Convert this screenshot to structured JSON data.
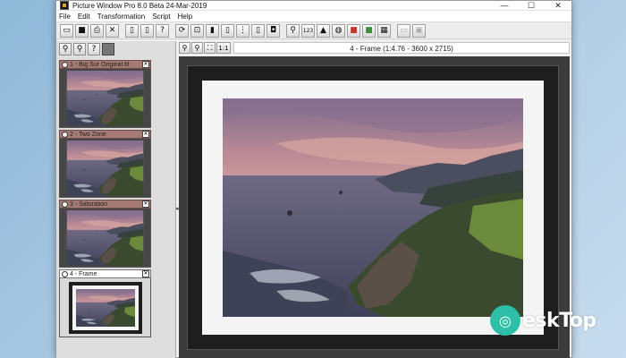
{
  "window": {
    "title": "Picture Window Pro 8.0 Beta 24-Mar-2019",
    "controls": {
      "minimize": "—",
      "maximize": "☐",
      "close": "✕"
    }
  },
  "menu": [
    "File",
    "Edit",
    "Transformation",
    "Script",
    "Help"
  ],
  "toolbar": {
    "buttons": [
      {
        "name": "new-window-button",
        "glyph": "▭"
      },
      {
        "name": "open-button",
        "glyph": "■"
      },
      {
        "name": "print-button",
        "glyph": "⎙"
      },
      {
        "name": "close-image-button",
        "glyph": "✕"
      },
      {
        "name": "copy-button",
        "glyph": "▯"
      },
      {
        "name": "paste-button",
        "glyph": "▯"
      },
      {
        "name": "help-button",
        "glyph": "?"
      },
      {
        "name": "rotate-button",
        "glyph": "⟳"
      },
      {
        "name": "crop-button",
        "glyph": "⊡"
      },
      {
        "name": "compare-button",
        "glyph": "▮"
      },
      {
        "name": "view-button",
        "glyph": "▯"
      },
      {
        "name": "split-button",
        "glyph": "⋮"
      },
      {
        "name": "frame-button",
        "glyph": "▯"
      },
      {
        "name": "mask-button",
        "glyph": "◘"
      },
      {
        "name": "loupe-button",
        "glyph": "⚲"
      },
      {
        "name": "value-button",
        "glyph": "123"
      },
      {
        "name": "histogram-button",
        "glyph": "▲"
      },
      {
        "name": "color-button",
        "glyph": "◍"
      },
      {
        "name": "red-channel-button",
        "glyph": "■"
      },
      {
        "name": "green-channel-button",
        "glyph": "■"
      },
      {
        "name": "grid-button",
        "glyph": "▦"
      },
      {
        "name": "monitor-button",
        "glyph": "▭"
      },
      {
        "name": "settings-button",
        "glyph": "▣"
      }
    ]
  },
  "left_tools": [
    "⚲",
    "⚲",
    "?",
    ""
  ],
  "thumbnails": [
    {
      "title": "1 - Big Sur Original.tif",
      "selected": false
    },
    {
      "title": "2 - Two Zone",
      "selected": false
    },
    {
      "title": "3 - Saturation",
      "selected": false
    },
    {
      "title": "4 - Frame",
      "selected": true
    }
  ],
  "viewer": {
    "tools": [
      "⚲",
      "⚲",
      "⛶",
      "1:1"
    ],
    "title": "4 - Frame (1:4.76 - 3600 x 2715)"
  },
  "watermark": {
    "logo": "◎",
    "text": "eskTop"
  },
  "colors": {
    "thumb_header": "#a57a74",
    "canvas_bg": "#3b3b3b",
    "mat": "#f4f4f4",
    "frame": "#1e1e1e"
  }
}
